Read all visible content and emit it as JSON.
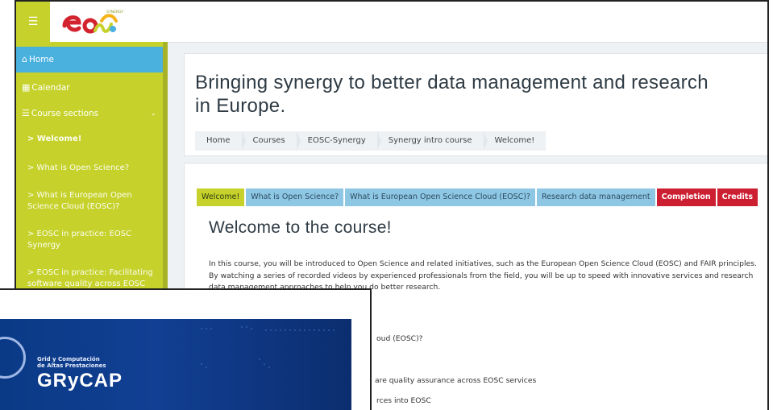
{
  "colors": {
    "accent": "#c6d22b",
    "active": "#4ab0de",
    "red": "#cc1f31",
    "blue_tab": "#8ec7e3",
    "green_tab": "#c6d22b"
  },
  "logo": {
    "text": "eOSC",
    "subtitle": "SYNERGY"
  },
  "sidebar": {
    "items": [
      {
        "icon": "home-icon",
        "label": "Home"
      },
      {
        "icon": "calendar-icon",
        "label": "Calendar"
      },
      {
        "icon": "list-icon",
        "label": "Course sections"
      }
    ],
    "sections": [
      "> Welcome!",
      "> What is Open Science?",
      "> What is European Open Science Cloud (EOSC)?",
      "> EOSC in practice: EOSC Synergy",
      "> EOSC in practice: Facilitating software quality across EOSC services"
    ]
  },
  "page": {
    "title": "Bringing synergy to better data management and research in Europe.",
    "breadcrumb": [
      "Home",
      "Courses",
      "EOSC-Synergy",
      "Synergy intro course",
      "Welcome!"
    ]
  },
  "tabs": [
    {
      "label": "Welcome!",
      "color": "#c6d22b",
      "text": "#2d3b10"
    },
    {
      "label": "What is Open Science?",
      "color": "#8ec7e3",
      "text": "#2d4b63"
    },
    {
      "label": "What is European Open Science Cloud (EOSC)?",
      "color": "#8ec7e3",
      "text": "#2d4b63"
    },
    {
      "label": "Research data management",
      "color": "#8ec7e3",
      "text": "#2d4b63"
    },
    {
      "label": "Completion",
      "color": "#cc1f31",
      "text": "#ffffff"
    },
    {
      "label": "Credits",
      "color": "#cc1f31",
      "text": "#ffffff"
    }
  ],
  "content": {
    "heading": "Welcome to the course!",
    "paragraph": "In this course, you will be introduced to Open Science and related initiatives, such as the European Open Science Cloud (EOSC) and FAIR principles. By watching a series of recorded videos by experienced professionals from the field, you will be up to speed with innovative services and research data management approaches to help you do better research.",
    "list_fragments": [
      "oud (EOSC)?",
      "are quality assurance across EOSC services",
      "rces into EOSC"
    ]
  },
  "popup": {
    "line1": "Grid y Computación",
    "line2": "de Altas Prestaciones",
    "brand": "GRyCAP"
  }
}
